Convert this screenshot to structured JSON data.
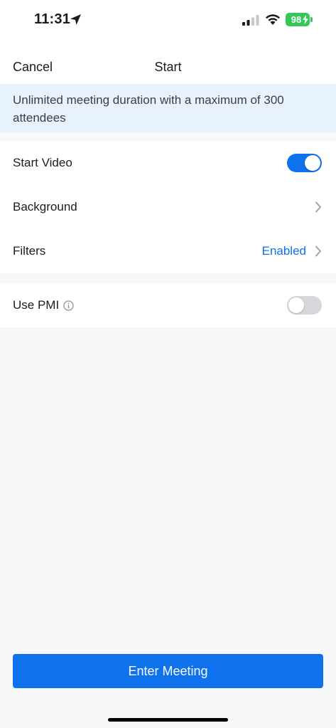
{
  "status_bar": {
    "time": "11:31",
    "battery_level": "98",
    "icons": [
      "location-arrow-icon",
      "cellular-signal-icon",
      "wifi-icon",
      "battery-charging-icon"
    ]
  },
  "nav": {
    "cancel_label": "Cancel",
    "title": "Start"
  },
  "banner": {
    "text": "Unlimited meeting duration with a maximum of 300 attendees"
  },
  "settings": {
    "start_video": {
      "label": "Start Video",
      "enabled": true
    },
    "background": {
      "label": "Background"
    },
    "filters": {
      "label": "Filters",
      "value": "Enabled"
    },
    "use_pmi": {
      "label": "Use PMI",
      "enabled": false
    }
  },
  "footer": {
    "enter_meeting_label": "Enter Meeting"
  },
  "colors": {
    "accent": "#0e72ed",
    "banner_bg": "#e8f2fd",
    "page_bg": "#f7f8fa",
    "battery": "#34c759"
  }
}
